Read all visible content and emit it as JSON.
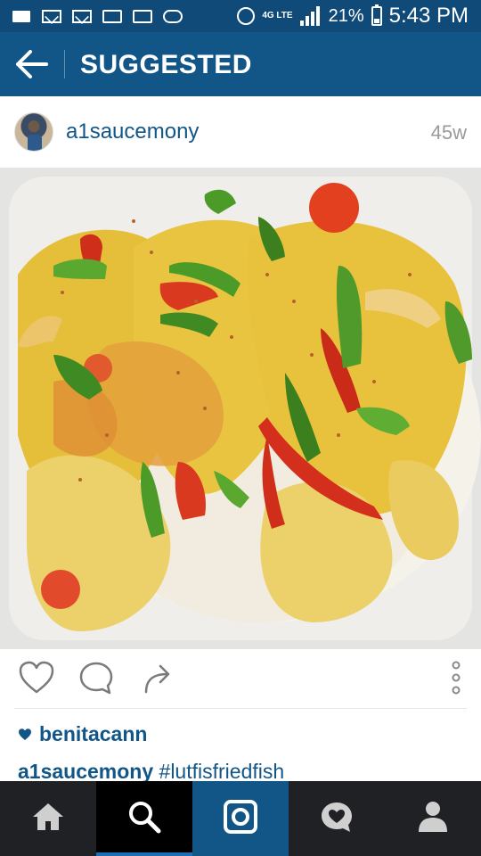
{
  "status_bar": {
    "battery_percent": "21%",
    "time": "5:43 PM",
    "network": "4G LTE"
  },
  "header": {
    "title": "SUGGESTED",
    "back_icon": "arrow-left-icon"
  },
  "post": {
    "username": "a1saucemony",
    "age": "45w",
    "photo_description_colors": {
      "rice": "#f3f1ea",
      "fish": "#e8c53a",
      "red_pepper": "#d9331f",
      "green_pepper": "#4f9a2a"
    }
  },
  "actions": {
    "like_icon": "heart-outline-icon",
    "comment_icon": "speech-bubble-icon",
    "share_icon": "share-arrow-icon",
    "more_icon": "vertical-dots-icon"
  },
  "likes": {
    "liker": "benitacann"
  },
  "caption": {
    "username": "a1saucemony",
    "text": "#lutfisfriedfish"
  },
  "bottom_nav": {
    "items": [
      "home-icon",
      "search-icon",
      "camera-icon",
      "activity-heart-icon",
      "profile-icon"
    ],
    "active": "search-icon"
  },
  "colors": {
    "status_bar": "#0f4a78",
    "header": "#125688",
    "link": "#125688",
    "bottom_nav": "#202124"
  }
}
